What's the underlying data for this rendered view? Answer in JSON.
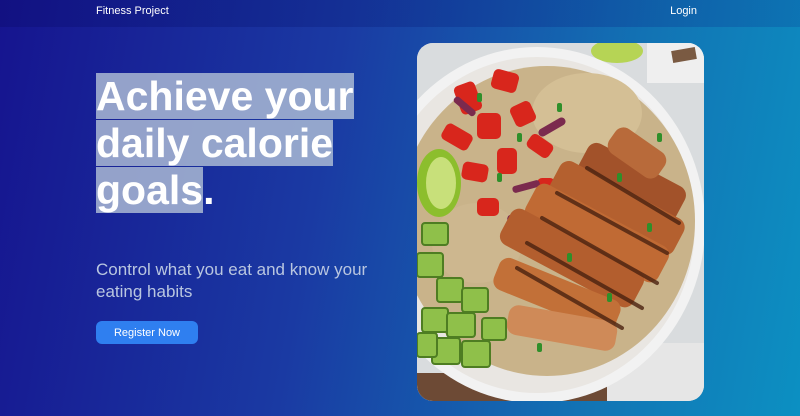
{
  "nav": {
    "brand": "Fitness Project",
    "login": "Login"
  },
  "hero": {
    "title_line1": "Achieve your",
    "title_line2": "daily calorie",
    "title_line3_highlight": "goals",
    "title_line3_tail": ".",
    "subtitle": "Control what you eat and know your eating habits",
    "cta_label": "Register Now"
  },
  "image": {
    "subject": "bowl-of-grilled-chicken-quinoa-peppers-avocado-lime"
  },
  "colors": {
    "bg_left": "#16148f",
    "bg_right": "#0c90c2",
    "highlight": "#b0bed6",
    "button": "#2f7ff0",
    "subtitle": "#b9c6e0"
  }
}
